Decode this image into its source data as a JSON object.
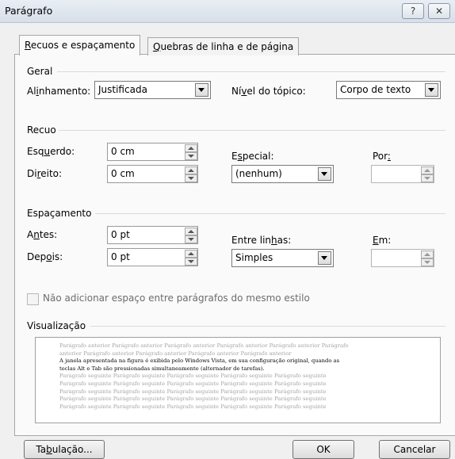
{
  "window": {
    "title": "Parágrafo",
    "help_glyph": "?",
    "close_glyph": "✕"
  },
  "tabs": [
    {
      "label_pre": "",
      "accel": "R",
      "label_post": "ecuos e espaçamento",
      "selected": true
    },
    {
      "label_pre": "",
      "accel": "Q",
      "label_post": "uebras de linha e de página",
      "selected": false
    }
  ],
  "geral": {
    "section": "Geral",
    "alinhamento_pre": "Al",
    "alinhamento_accel": "i",
    "alinhamento_post": "nhamento:",
    "alinhamento_value": "Justificada",
    "nivel_pre": "Ní",
    "nivel_accel": "v",
    "nivel_post": "el do tópico:",
    "nivel_value": "Corpo de texto"
  },
  "recuo": {
    "section": "Recuo",
    "esquerdo_pre": "Esq",
    "esquerdo_accel": "u",
    "esquerdo_post": "erdo:",
    "esquerdo_value": "0 cm",
    "direito_pre": "Di",
    "direito_accel": "r",
    "direito_post": "eito:",
    "direito_value": "0 cm",
    "especial_pre": "E",
    "especial_accel": "s",
    "especial_post": "pecial:",
    "especial_value": "(nenhum)",
    "por_pre": "Por",
    "por_accel": ":",
    "por_post": ""
  },
  "espacamento": {
    "section": "Espaçamento",
    "antes_pre": "A",
    "antes_accel": "n",
    "antes_post": "tes:",
    "antes_value": "0 pt",
    "depois_pre": "Dep",
    "depois_accel": "o",
    "depois_post": "is:",
    "depois_value": "0 pt",
    "entre_pre": "Entre lin",
    "entre_accel": "h",
    "entre_post": "as:",
    "entre_value": "Simples",
    "em_pre": "",
    "em_accel": "E",
    "em_post": "m:"
  },
  "checkbox_label": "Não adicionar espaço entre parágrafos do mesmo estilo",
  "visualizacao": {
    "section": "Visualização",
    "prev_lines": [
      "Parágrafo anterior Parágrafo anterior Parágrafo anterior Parágrafo anterior Parágrafo anterior Parágrafo",
      "anterior Parágrafo anterior Parágrafo anterior Parágrafo anterior Parágrafo anterior"
    ],
    "current_lines": [
      "A janela apresentada na figura é exibida pelo Windows Vista, em sua configuração original, quando as",
      "teclas Alt e Tab são pressionadas simultaneamente (alternador de tarefas)."
    ],
    "next_lines": [
      "Parágrafo seguinte Parágrafo seguinte Parágrafo seguinte Parágrafo seguinte Parágrafo seguinte",
      "Parágrafo seguinte Parágrafo seguinte Parágrafo seguinte Parágrafo seguinte Parágrafo seguinte",
      "Parágrafo seguinte Parágrafo seguinte Parágrafo seguinte Parágrafo seguinte Parágrafo seguinte",
      "Parágrafo seguinte Parágrafo seguinte Parágrafo seguinte Parágrafo seguinte Parágrafo seguinte",
      "Parágrafo seguinte Parágrafo seguinte Parágrafo seguinte Parágrafo seguinte Parágrafo seguinte"
    ]
  },
  "buttons": {
    "tabulacao_pre": "Ta",
    "tabulacao_accel": "b",
    "tabulacao_post": "ulação...",
    "ok": "OK",
    "cancelar": "Cancelar"
  }
}
